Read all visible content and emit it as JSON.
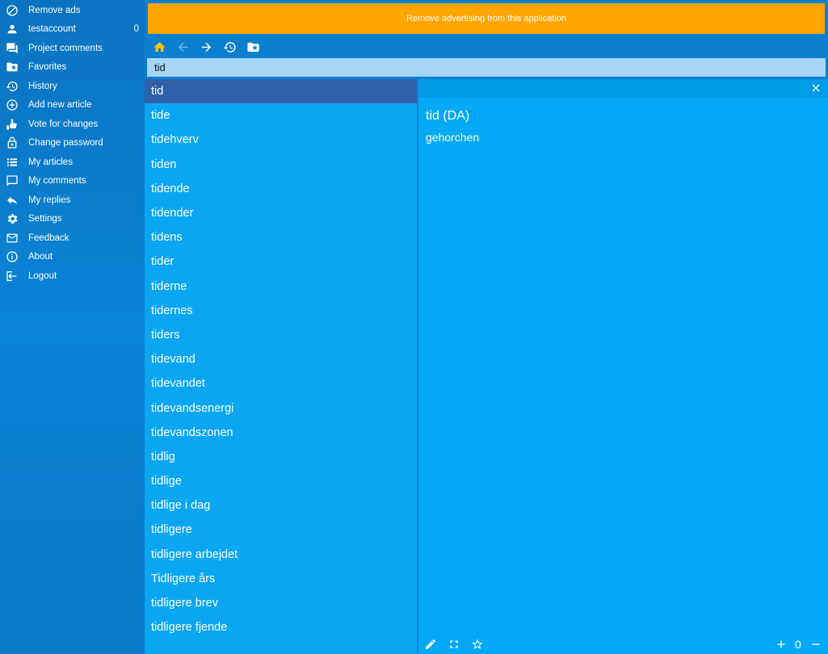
{
  "sidebar": {
    "items": [
      {
        "icon": "block-icon",
        "label": "Remove ads"
      },
      {
        "icon": "person-icon",
        "label": "testaccount",
        "count": "0"
      },
      {
        "icon": "comments-icon",
        "label": "Project comments"
      },
      {
        "icon": "favorite-folder-icon",
        "label": "Favorites"
      },
      {
        "icon": "history-icon",
        "label": "History"
      },
      {
        "icon": "add-circle-icon",
        "label": "Add new article"
      },
      {
        "icon": "vote-icon",
        "label": "Vote for changes"
      },
      {
        "icon": "lock-icon",
        "label": "Change password"
      },
      {
        "icon": "list-icon",
        "label": "My articles"
      },
      {
        "icon": "comment-icon",
        "label": "My comments"
      },
      {
        "icon": "reply-icon",
        "label": "My replies"
      },
      {
        "icon": "gear-icon",
        "label": "Settings"
      },
      {
        "icon": "mail-icon",
        "label": "Feedback"
      },
      {
        "icon": "info-icon",
        "label": "About"
      },
      {
        "icon": "logout-icon",
        "label": "Logout"
      }
    ]
  },
  "ad": {
    "text": "Remove advertising from this application",
    "color": "#ffa500"
  },
  "toolbar": {
    "icons": [
      "home-icon",
      "back-arrow-icon",
      "forward-arrow-icon",
      "history-icon",
      "favorite-folder-icon"
    ],
    "home_color": "#ffc107"
  },
  "search": {
    "value": "tid"
  },
  "wordlist": {
    "selected": "tid",
    "items": [
      "tid",
      "tide",
      "tidehverv",
      "tiden",
      "tidende",
      "tidender",
      "tidens",
      "tider",
      "tiderne",
      "tidernes",
      "tiders",
      "tidevand",
      "tidevandet",
      "tidevandsenergi",
      "tidevandszonen",
      "tidlig",
      "tidlige",
      "tidlige i dag",
      "tidligere",
      "tidligere arbejdet",
      "Tidligere års",
      "tidligere brev",
      "tidligere fjende"
    ]
  },
  "detail": {
    "title": "tid (DA)",
    "translation": "gehorchen",
    "zoom": "0",
    "bottom_icons": [
      "edit-icon",
      "fullscreen-icon",
      "star-icon",
      "zoom-in-icon",
      "zoom-out-icon"
    ]
  }
}
